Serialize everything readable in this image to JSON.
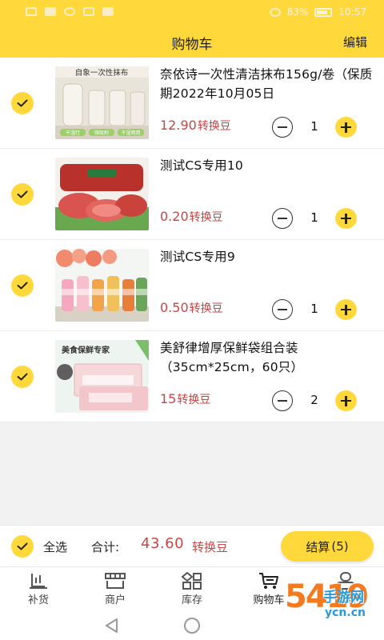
{
  "status_bar": {
    "battery": "83%",
    "time": "10:57"
  },
  "navbar": {
    "title": "购物车",
    "edit_label": "编辑"
  },
  "items": [
    {
      "title": "奈依诗一次性清洁抹布156g/卷（保质期2022年10月05日",
      "price": "12.90",
      "unit": "转换豆",
      "quantity": "1",
      "checked": true,
      "image_text": "自象一次性抹布",
      "image_tags": [
        "干湿行",
        "强吸附",
        "干湿两用"
      ]
    },
    {
      "title": "测试CS专用10",
      "price": "0.20",
      "unit": "转换豆",
      "quantity": "1",
      "checked": true
    },
    {
      "title": "测试CS专用9",
      "price": "0.50",
      "unit": "转换豆",
      "quantity": "1",
      "checked": true
    },
    {
      "title": "美舒律增厚保鲜袋组合装（35cm*25cm，60只）",
      "price": "15",
      "unit": "转换豆",
      "quantity": "2",
      "checked": true,
      "image_text": "美食保鲜专家"
    }
  ],
  "checkout": {
    "select_all": "全选",
    "total_label": "合计:",
    "total": "43.60",
    "unit": "转换豆",
    "button_label": "结算",
    "button_count": "(5)"
  },
  "tabs": [
    {
      "label": "补货",
      "icon": "restock-icon",
      "active": false
    },
    {
      "label": "商户",
      "icon": "store-icon",
      "active": false
    },
    {
      "label": "库存",
      "icon": "inventory-icon",
      "active": false
    },
    {
      "label": "购物车",
      "icon": "cart-icon",
      "active": true
    },
    {
      "label": "我的",
      "icon": "profile-icon",
      "active": false
    }
  ],
  "watermark": {
    "number": "5419",
    "name": "手游网",
    "domain": "ycn.cn"
  },
  "colors": {
    "accent": "#ffd93b",
    "price": "#c94444",
    "watermark_orange": "#f37a1e",
    "watermark_blue": "#2a9ad8"
  }
}
